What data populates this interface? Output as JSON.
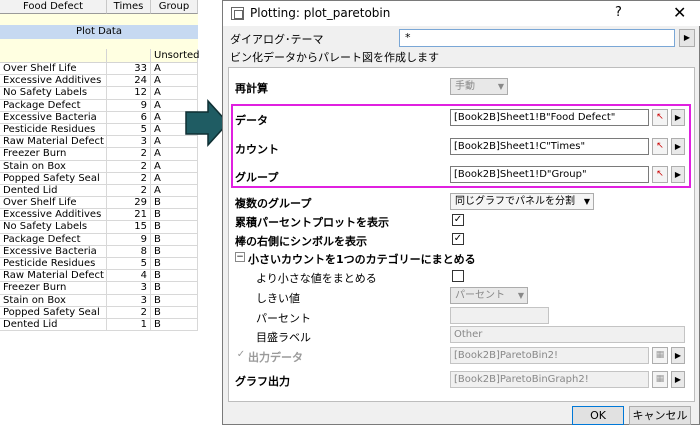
{
  "sheet": {
    "headers": [
      "Food Defect",
      "Times",
      "Group"
    ],
    "plot_data_label": "Plot Data",
    "group_meta": "Unsorted",
    "rows": [
      {
        "t": "Over Shelf Life",
        "n": "33",
        "g": "A"
      },
      {
        "t": "Excessive Additives",
        "n": "24",
        "g": "A"
      },
      {
        "t": "No Safety Labels",
        "n": "12",
        "g": "A"
      },
      {
        "t": "Package Defect",
        "n": "9",
        "g": "A"
      },
      {
        "t": "Excessive Bacteria",
        "n": "6",
        "g": "A"
      },
      {
        "t": "Pesticide Residues",
        "n": "5",
        "g": "A"
      },
      {
        "t": "Raw Material Defect",
        "n": "3",
        "g": "A"
      },
      {
        "t": "Freezer Burn",
        "n": "2",
        "g": "A"
      },
      {
        "t": "Stain on Box",
        "n": "2",
        "g": "A"
      },
      {
        "t": "Popped Safety Seal",
        "n": "2",
        "g": "A"
      },
      {
        "t": "Dented Lid",
        "n": "2",
        "g": "A"
      },
      {
        "t": "Over Shelf Life",
        "n": "29",
        "g": "B"
      },
      {
        "t": "Excessive Additives",
        "n": "21",
        "g": "B"
      },
      {
        "t": "No Safety Labels",
        "n": "15",
        "g": "B"
      },
      {
        "t": "Package Defect",
        "n": "9",
        "g": "B"
      },
      {
        "t": "Excessive Bacteria",
        "n": "8",
        "g": "B"
      },
      {
        "t": "Pesticide Residues",
        "n": "5",
        "g": "B"
      },
      {
        "t": "Raw Material Defect",
        "n": "4",
        "g": "B"
      },
      {
        "t": "Freezer Burn",
        "n": "3",
        "g": "B"
      },
      {
        "t": "Stain on Box",
        "n": "3",
        "g": "B"
      },
      {
        "t": "Popped Safety Seal",
        "n": "2",
        "g": "B"
      },
      {
        "t": "Dented Lid",
        "n": "1",
        "g": "B"
      }
    ]
  },
  "dialog": {
    "title": "Plotting: plot_paretobin",
    "help": "?",
    "close": "✕",
    "theme_label": "ダイアログ･テーマ",
    "theme_value": "*",
    "description": "ビン化データからパレート図を作成します",
    "recalc_label": "再計算",
    "recalc_value": "手動",
    "data_label": "データ",
    "data_value": "[Book2B]Sheet1!B\"Food Defect\"",
    "count_label": "カウント",
    "count_value": "[Book2B]Sheet1!C\"Times\"",
    "group_label": "グループ",
    "group_value": "[Book2B]Sheet1!D\"Group\"",
    "multi_group_label": "複数のグループ",
    "multi_group_value": "同じグラフでパネルを分割",
    "cumulative_label": "累積パーセントプロットを表示",
    "symbol_label": "棒の右側にシンボルを表示",
    "small_count_label": "小さいカウントを1つのカテゴリーにまとめる",
    "combine_smaller_label": "より小さな値をまとめる",
    "threshold_label": "しきい値",
    "threshold_value": "パーセント",
    "percent_label": "パーセント",
    "tick_label": "目盛ラベル",
    "tick_value": "Other",
    "output_data_label": "出力データ",
    "output_data_value": "[Book2B]ParetoBin2!",
    "graph_output_label": "グラフ出力",
    "graph_output_value": "[Book2B]ParetoBinGraph2!",
    "ok": "OK",
    "cancel": "キャンセル"
  },
  "colors": {
    "highlight": "#e020e0",
    "arrow": "#1f5c63",
    "plot_data_bg": "#c6d9f1",
    "sheet_bg": "#ffffe1"
  }
}
